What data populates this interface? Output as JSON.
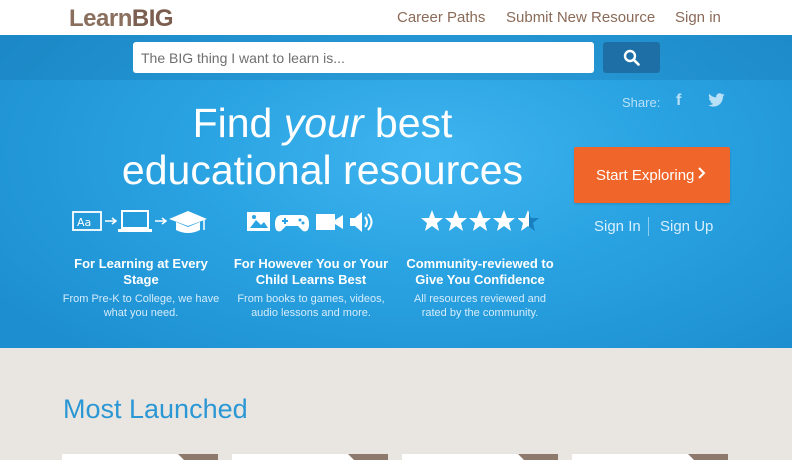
{
  "header": {
    "logo_learn": "Learn",
    "logo_big": "BIG",
    "nav": {
      "career": "Career Paths",
      "submit": "Submit New Resource",
      "signin": "Sign in"
    }
  },
  "search": {
    "placeholder": "The BIG thing I want to learn is...",
    "button_icon": "search-icon"
  },
  "share": {
    "label": "Share:",
    "facebook": "f",
    "twitter_icon": "twitter-icon"
  },
  "hero": {
    "line1_pre": "Find ",
    "line1_em": "your",
    "line1_post": " best",
    "line2": "educational resources",
    "cta": "Start Exploring",
    "signin": "Sign In",
    "signup": "Sign Up"
  },
  "features": [
    {
      "icons": [
        "text-icon",
        "arrow-icon",
        "laptop-icon",
        "arrow-icon",
        "graduation-cap-icon"
      ],
      "text_icon_label": "Aa",
      "title": "For Learning at Every Stage",
      "desc": "From Pre-K to College, we have what you need."
    },
    {
      "icons": [
        "image-icon",
        "gamepad-icon",
        "video-icon",
        "speaker-icon"
      ],
      "title": "For However You or Your Child Learns Best",
      "desc": "From books to games, videos, audio lessons and more."
    },
    {
      "icons": [
        "star-icon"
      ],
      "rating": 4.5,
      "rating_max": 5,
      "title": "Community-reviewed to Give You Confidence",
      "desc": "All resources reviewed and rated by the community."
    }
  ],
  "section": {
    "title": "Most Launched"
  },
  "colors": {
    "brand_brown": "#8a6e5e",
    "hero_blue": "#2aa3e2",
    "cta_orange": "#f0662a",
    "section_blue": "#2b97d4",
    "lower_bg": "#e9e6e1"
  }
}
